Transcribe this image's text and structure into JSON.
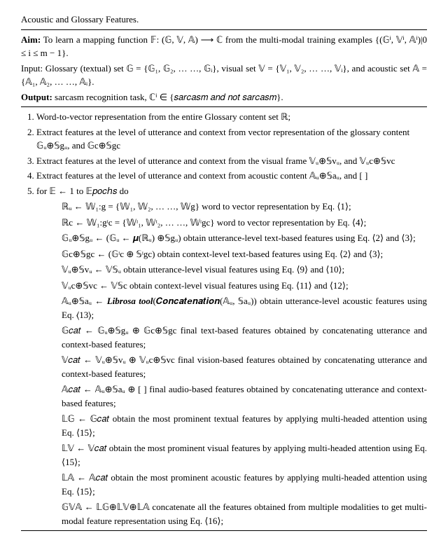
{
  "title": "Acoustic and Glossary Features.",
  "aim": "To learn a mapping function 𝔽: (𝔾, 𝕍, 𝔸) ⟶ ℂ from the multi-modal training examples {(𝔾ⁱ, 𝕍ⁱ, 𝔸ⁱ)|0 ≤ i ≤ m − 1}.",
  "input": "Glossary (textual) set 𝔾 = {𝔾₁, 𝔾₂, … …, 𝔾ᵢ}, visual set 𝕍 = {𝕍₁, 𝕍₂, … …, 𝕍ᵢ}, and acoustic set 𝔸 = {𝔸₁, 𝔸₂, … …, 𝔸ᵢ}.",
  "output_label": "Output:",
  "output": "sarcasm recognition task, ℂⁱ ∈ {𝑠𝑎𝑟𝑐𝑎𝑠𝑚 𝑎𝑛𝑑 𝑛𝑜𝑡 𝑠𝑎𝑟𝑐𝑎𝑠𝑚}.",
  "step1": "Word-to-vector representation from the entire Glossary content set ℝ;",
  "step2": "Extract features at the level of utterance and context from vector representation of the glossary content 𝔾ᵤ⊕𝕊gᵤ, and  𝔾c⊕𝕊gc",
  "step3": "Extract features at the level of utterance and context from the visual frame 𝕍ᵤ⊕𝕊vᵤ, and  𝕍ᵤc⊕𝕊vc",
  "step4": "Extract features at the level of utterance and context from acoustic content 𝔸ᵤ⊕𝕊aᵤ, and [ ]",
  "step5_head": "for 𝔼 ← 1 to 𝔼𝑝𝑜𝑐ℎ𝑠 do",
  "lines": {
    "l1": "ℝᵤ ← 𝕎₁:g = {𝕎₁, 𝕎₂, … …, 𝕎g} word to vector representation by Eq. ⟨1⟩;",
    "l2": "ℝc ← 𝕎₁:gᶦc = {𝕎ᶦ₁, 𝕎ᶦ₂, … …, 𝕎ᶦgc} word to vector representation by Eq. ⟨4⟩;",
    "l3": "𝔾ᵤ⊕𝕊gᵤ ← (𝔾ᵤ ← 𝝁(ℝᵤ) ⊕𝕊gᵤ) obtain utterance-level text-based features using Eq. ⟨2⟩ and ⟨3⟩;",
    "l4": "𝔾c⊕𝕊gc ← (𝔾ᶦc ⊕ 𝕊ᶦgc) obtain context-level text-based features using Eq. ⟨2⟩ and ⟨3⟩;",
    "l5": "𝕍ᵤ⊕𝕊vᵤ ← 𝕍𝕊ᵤ obtain utterance-level visual features using Eq. ⟨9⟩ and ⟨10⟩;",
    "l6": "𝕍ᵤc⊕𝕊vc ← 𝕍𝕊c obtain context-level visual features using Eq. ⟨11⟩ and ⟨12⟩;",
    "l7p": "𝔸ᵤ⊕𝕊aᵤ ← ",
    "l7b": "Librosa tool",
    "l7c": "(𝑪𝒐𝒏𝒄𝒂𝒕𝒆𝒏𝒂𝒕𝒊𝒐𝒏(𝔸ᵤ, 𝕊aᵤ))",
    "l7s": " obtain utterance-level acoustic features using Eq. ⟨13⟩;",
    "l8": "𝔾𝑐𝑎𝑡 ← 𝔾ᵤ⊕𝕊gᵤ ⊕ 𝔾c⊕𝕊gc final text-based features obtained by concatenating utterance and context-based features;",
    "l9": "𝕍𝑐𝑎𝑡 ← 𝕍ᵤ⊕𝕊vᵤ ⊕ 𝕍ᵤc⊕𝕊vc final vision-based features obtained by concatenating utterance and context-based features;",
    "l10": "𝔸𝑐𝑎𝑡 ← 𝔸ᵤ⊕𝕊aᵤ ⊕ [ ] final audio-based features obtained by concatenating utterance and context-based features;",
    "l11": "𝕃𝔾 ← 𝔾𝑐𝑎𝑡 obtain the most prominent textual features by applying multi-headed attention using Eq. ⟨15⟩;",
    "l12": "𝕃𝕍 ← 𝕍𝑐𝑎𝑡 obtain the most prominent visual features by applying multi-headed attention using Eq. ⟨15⟩;",
    "l13": "𝕃𝔸 ← 𝔸𝑐𝑎𝑡 obtain the most prominent acoustic features by applying multi-headed attention using Eq. ⟨15⟩;",
    "l14": "𝔾𝕍𝔸 ← 𝕃𝔾⊕𝕃𝕍⊕𝕃𝔸 concatenate all the features obtained from multiple modalities to get multi-modal feature representation using Eq. ⟨16⟩;"
  }
}
